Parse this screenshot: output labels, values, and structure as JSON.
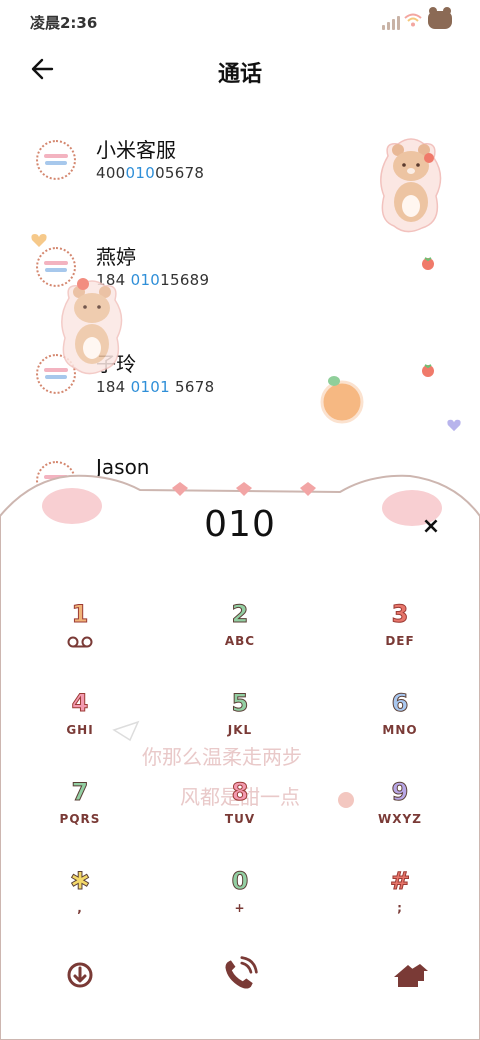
{
  "status_bar": {
    "time": "凌晨2:36"
  },
  "header": {
    "title": "通话"
  },
  "contacts": [
    {
      "name": "小米客服",
      "number_parts": [
        "400",
        "010",
        "05678"
      ]
    },
    {
      "name": "燕婷",
      "number_parts": [
        "184 ",
        "010",
        "15689"
      ]
    },
    {
      "name": "子玲",
      "number_parts": [
        "184 ",
        "0101",
        " 5678"
      ]
    },
    {
      "name": "Jason",
      "number_parts": [
        "",
        "",
        ""
      ]
    }
  ],
  "dialer": {
    "typed": "010",
    "clear_symbol": "×",
    "watermark_lines": [
      "你那么温柔走两步",
      "风都是甜一点"
    ],
    "keys": [
      {
        "digit": "1",
        "letters": ""
      },
      {
        "digit": "2",
        "letters": "ABC"
      },
      {
        "digit": "3",
        "letters": "DEF"
      },
      {
        "digit": "4",
        "letters": "GHI"
      },
      {
        "digit": "5",
        "letters": "JKL"
      },
      {
        "digit": "6",
        "letters": "MNO"
      },
      {
        "digit": "7",
        "letters": "PQRS"
      },
      {
        "digit": "8",
        "letters": "TUV"
      },
      {
        "digit": "9",
        "letters": "WXYZ"
      },
      {
        "digit": "✱",
        "letters": ","
      },
      {
        "digit": "0",
        "letters": "+"
      },
      {
        "digit": "#",
        "letters": ";"
      }
    ]
  },
  "icons": {
    "back": "arrow-left-icon",
    "voicemail": "voicemail-icon",
    "collapse": "collapse-dialpad-icon",
    "call": "call-icon",
    "more": "house-icon"
  },
  "colors": {
    "accent": "#2f8fd8",
    "brown": "#7a3a36",
    "pink": "#f6c9cf"
  }
}
